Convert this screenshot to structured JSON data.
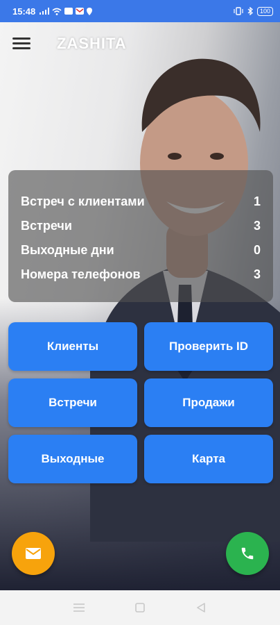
{
  "status_bar": {
    "time": "15:48",
    "battery": "100",
    "icons": [
      "signal-icon",
      "wifi-icon",
      "app-icon",
      "gmail-icon",
      "location-icon",
      "vibrate-icon",
      "bluetooth-icon"
    ]
  },
  "app_bar": {
    "title": "ZASHITA",
    "menu_icon": "hamburger-icon"
  },
  "stats": [
    {
      "label": "Встреч с клиентами",
      "value": "1"
    },
    {
      "label": "Встречи",
      "value": "3"
    },
    {
      "label": "Выходные дни",
      "value": "0"
    },
    {
      "label": "Номера телефонов",
      "value": "3"
    }
  ],
  "buttons": {
    "clients": "Клиенты",
    "check_id": "Проверить ID",
    "meetings": "Встречи",
    "sales": "Продажи",
    "days_off": "Выходные",
    "map": "Карта"
  },
  "fabs": {
    "mail_icon": "mail-icon",
    "call_icon": "phone-icon"
  },
  "colors": {
    "status_bar": "#3b78e8",
    "button": "#2b7ff3",
    "fab_mail": "#f7a30c",
    "fab_call": "#2bb34f"
  },
  "nav_bar": {
    "icons": [
      "menu-icon",
      "home-square-icon",
      "back-triangle-icon"
    ]
  }
}
